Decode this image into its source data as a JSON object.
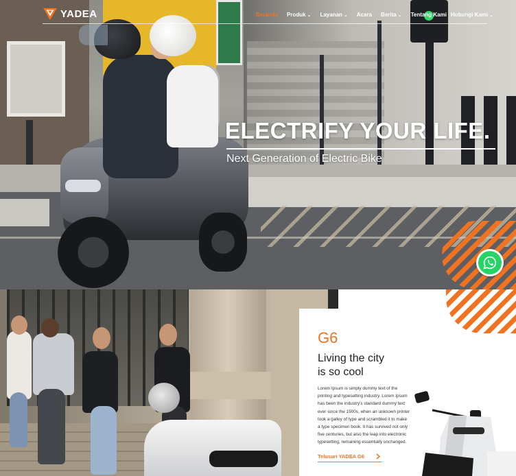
{
  "brand": {
    "name": "YADEA",
    "accent": "#f07322"
  },
  "nav": {
    "items": [
      {
        "label": "Beranda",
        "active": true,
        "has_dropdown": false
      },
      {
        "label": "Produk",
        "active": false,
        "has_dropdown": true
      },
      {
        "label": "Layanan",
        "active": false,
        "has_dropdown": true
      },
      {
        "label": "Acara",
        "active": false,
        "has_dropdown": false
      },
      {
        "label": "Berita",
        "active": false,
        "has_dropdown": true
      },
      {
        "label": "Tentang Kami",
        "active": false,
        "has_dropdown": false
      },
      {
        "label": "Hubungi Kami",
        "active": false,
        "has_dropdown": true
      }
    ]
  },
  "hero": {
    "title": "ELECTRIFY YOUR LIFE.",
    "subtitle": "Next Generation of Electric Bike"
  },
  "whatsapp": {
    "icon": "whatsapp-icon",
    "color": "#25d366"
  },
  "feature": {
    "model": "G6",
    "tagline_line1": "Living the city",
    "tagline_line2": "is so cool",
    "body": "Lorem Ipsum is simply dummy text of the printing and typesetting industry. Lorem Ipsum has been the industry's standard dummy text ever since the 1500s, when an unknown printer took a galley of type and scrambled it to make a type specimen book. It has survived not only five centuries, but also the leap into electronic typesetting, remaining essentially unchanged.",
    "cta_label": "Telusuri YADEA G6"
  }
}
